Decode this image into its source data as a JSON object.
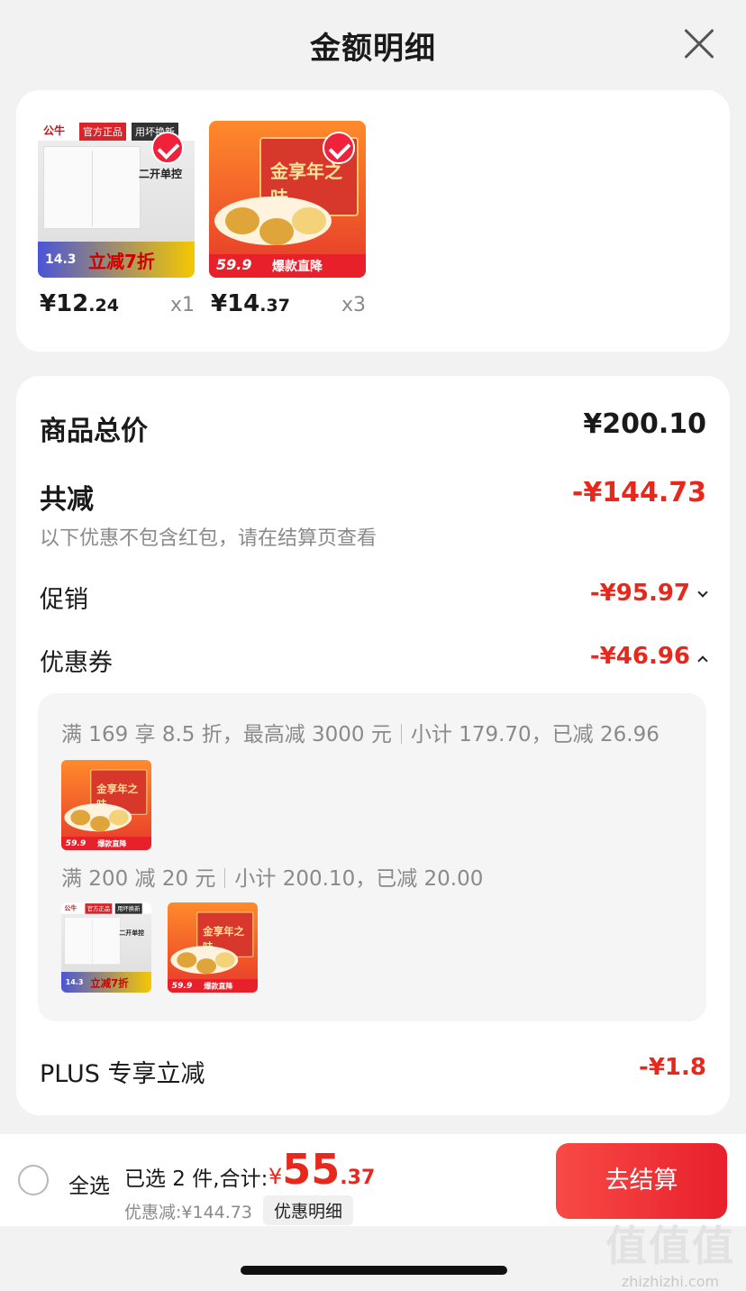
{
  "header": {
    "title": "金额明细"
  },
  "products": [
    {
      "price_int": "¥12",
      "price_dec": ".24",
      "qty": "x1",
      "art": {
        "brand": "公牛",
        "tag1": "官方正品",
        "tag2": "用坏换新",
        "label": "二开单控",
        "promo": "立减7折",
        "promo_num": "14.3"
      }
    },
    {
      "price_int": "¥14",
      "price_dec": ".37",
      "qty": "x3",
      "art": {
        "box": "金享年之味",
        "promo": "爆款直降",
        "promo_num": "59.9"
      }
    }
  ],
  "summary": {
    "total_label": "商品总价",
    "total_value": "¥200.10",
    "reduced_label": "共减",
    "reduced_value": "-¥144.73",
    "reduced_hint": "以下优惠不包含红包，请在结算页查看",
    "promo_label": "促销",
    "promo_value": "-¥95.97",
    "coupon_label": "优惠券",
    "coupon_value": "-¥46.96",
    "coupons": [
      {
        "rule": "满 169 享 8.5 折，最高减 3000 元",
        "subtotal": "小计 179.70，已减 26.96"
      },
      {
        "rule": "满 200 减 20 元",
        "subtotal": "小计 200.10，已减 20.00"
      }
    ],
    "plus_label": "PLUS 专享立减",
    "plus_value": "-¥1.8"
  },
  "bottom": {
    "select_all": "全选",
    "selected": "已选 2 件,合计:",
    "total_cur": "¥",
    "total_int": "55",
    "total_dec": ".37",
    "discount": "优惠减:¥144.73",
    "detail_button": "优惠明细",
    "checkout_button": "去结算"
  },
  "watermark": {
    "mark": "值值值",
    "site": "zhizhizhi.com"
  },
  "colors": {
    "accent": "#e8281c",
    "checkout": "#e8202c"
  }
}
